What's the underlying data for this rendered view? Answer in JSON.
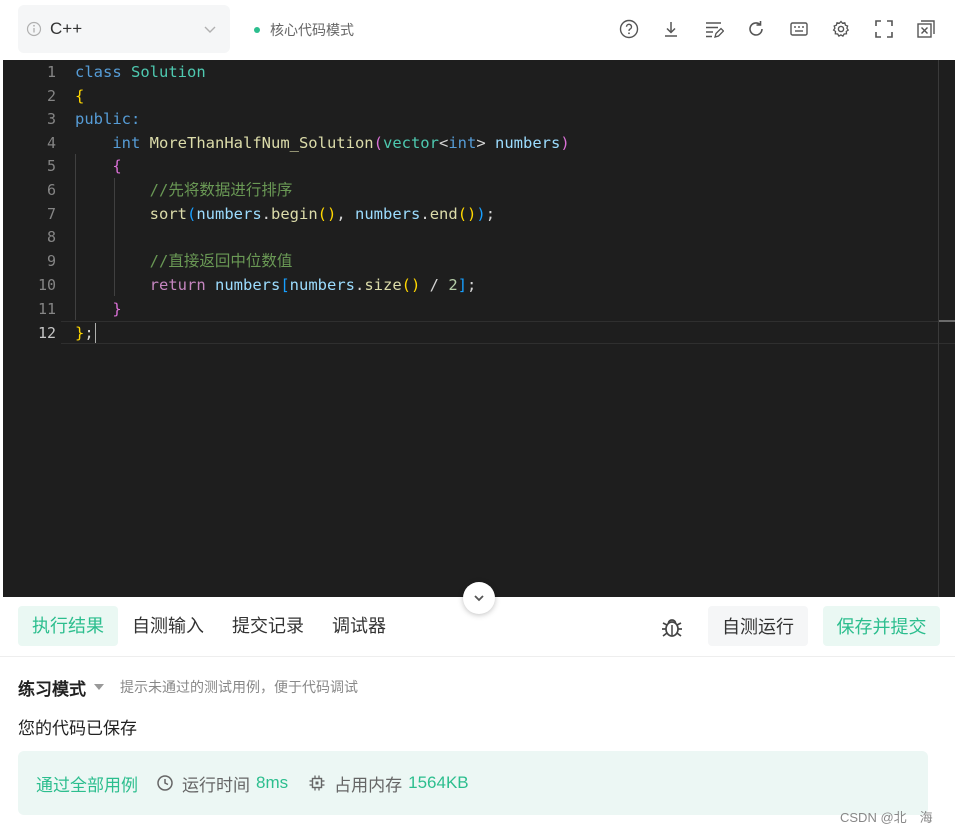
{
  "toolbar": {
    "language": "C++",
    "mode": "核心代码模式",
    "icons": [
      "help-icon",
      "download-icon",
      "format-icon",
      "reset-icon",
      "keyboard-icon",
      "settings-icon",
      "fullscreen-icon",
      "close-panel-icon"
    ]
  },
  "editor": {
    "line_numbers": [
      "1",
      "2",
      "3",
      "4",
      "5",
      "6",
      "7",
      "8",
      "9",
      "10",
      "11",
      "12"
    ],
    "lines": {
      "l1": {
        "kw": "class",
        "name": "Solution"
      },
      "l2": {
        "brace": "{"
      },
      "l3": {
        "access": "public:"
      },
      "l4": {
        "type": "int",
        "fn": "MoreThanHalfNum_Solution",
        "lp": "(",
        "vec": "vector",
        "lt": "<",
        "inner": "int",
        "gt": ">",
        "param": "numbers",
        "rp": ")"
      },
      "l5": {
        "brace": "{"
      },
      "l6": {
        "comment": "//先将数据进行排序"
      },
      "l7": {
        "fn": "sort",
        "lp": "(",
        "a1": "numbers",
        "dot1": ".",
        "m1": "begin",
        "p1": "()",
        "comma": ", ",
        "a2": "numbers",
        "dot2": ".",
        "m2": "end",
        "p2": "()",
        "rp": ")",
        "semi": ";"
      },
      "l8": {},
      "l9": {
        "comment": "//直接返回中位数值"
      },
      "l10": {
        "kw": "return",
        "arr": "numbers",
        "lb": "[",
        "a": "numbers",
        "dot": ".",
        "m": "size",
        "p": "()",
        "op": " / ",
        "n": "2",
        "rb": "]",
        "semi": ";"
      },
      "l11": {
        "brace": "}"
      },
      "l12": {
        "brace": "}",
        "semi": ";"
      }
    }
  },
  "tabs": {
    "result": "执行结果",
    "custom_input": "自测输入",
    "submissions": "提交记录",
    "debugger": "调试器"
  },
  "actions": {
    "self_test": "自测运行",
    "save_submit": "保存并提交"
  },
  "practice": {
    "label": "练习模式",
    "hint": "提示未通过的测试用例，便于代码调试"
  },
  "status": {
    "saved": "您的代码已保存"
  },
  "result": {
    "pass": "通过全部用例",
    "time_label": "运行时间",
    "time_value": "8ms",
    "memory_label": "占用内存",
    "memory_value": "1564KB"
  },
  "watermark": "CSDN @北　海",
  "colors": {
    "accent": "#2cbe8e",
    "editor_bg": "#1e1e1e"
  }
}
